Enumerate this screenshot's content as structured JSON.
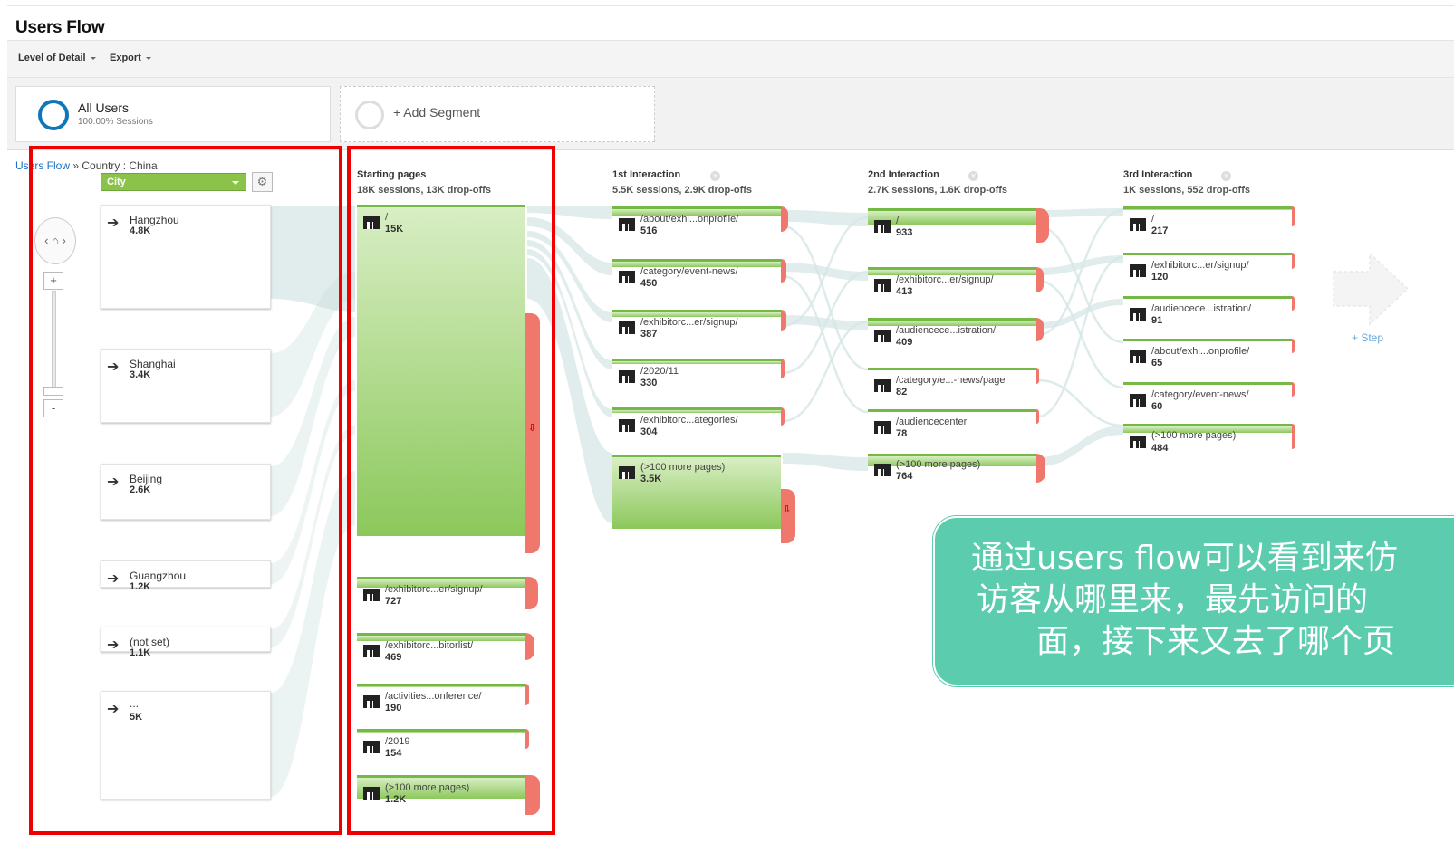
{
  "title": "Users Flow",
  "toolbar": {
    "level_of_detail": "Level of Detail",
    "export": "Export"
  },
  "segments": {
    "active": {
      "name": "All Users",
      "sub": "100.00% Sessions"
    },
    "add_label": "+ Add Segment"
  },
  "breadcrumb": {
    "root": "Users Flow",
    "sep": " » ",
    "current": "Country : China"
  },
  "dimension_select": {
    "value": "City"
  },
  "cities": [
    {
      "label": "Hangzhou",
      "value": "4.8K"
    },
    {
      "label": "Shanghai",
      "value": "3.4K"
    },
    {
      "label": "Beijing",
      "value": "2.6K"
    },
    {
      "label": "Guangzhou",
      "value": "1.2K"
    },
    {
      "label": "(not set)",
      "value": "1.1K"
    },
    {
      "label": "...",
      "value": "5K"
    }
  ],
  "columns": [
    {
      "title": "Starting pages",
      "sub": "18K sessions, 13K drop-offs",
      "nodes": [
        {
          "name": "/",
          "value": "15K"
        },
        {
          "name": "/exhibitorc...er/signup/",
          "value": "727"
        },
        {
          "name": "/exhibitorc...bitorlist/",
          "value": "469"
        },
        {
          "name": "/activities...onference/",
          "value": "190"
        },
        {
          "name": "/2019",
          "value": "154"
        },
        {
          "name": "(>100 more pages)",
          "value": "1.2K"
        }
      ]
    },
    {
      "title": "1st Interaction",
      "sub": "5.5K sessions, 2.9K drop-offs",
      "nodes": [
        {
          "name": "/about/exhi...onprofile/",
          "value": "516"
        },
        {
          "name": "/category/event-news/",
          "value": "450"
        },
        {
          "name": "/exhibitorc...er/signup/",
          "value": "387"
        },
        {
          "name": "/2020/11",
          "value": "330"
        },
        {
          "name": "/exhibitorc...ategories/",
          "value": "304"
        },
        {
          "name": "(>100 more pages)",
          "value": "3.5K"
        }
      ]
    },
    {
      "title": "2nd Interaction",
      "sub": "2.7K sessions, 1.6K drop-offs",
      "nodes": [
        {
          "name": "/",
          "value": "933"
        },
        {
          "name": "/exhibitorc...er/signup/",
          "value": "413"
        },
        {
          "name": "/audiencece...istration/",
          "value": "409"
        },
        {
          "name": "/category/e...-news/page",
          "value": "82"
        },
        {
          "name": "/audiencecenter",
          "value": "78"
        },
        {
          "name": "(>100 more pages)",
          "value": "764"
        }
      ]
    },
    {
      "title": "3rd Interaction",
      "sub": "1K sessions, 552 drop-offs",
      "nodes": [
        {
          "name": "/",
          "value": "217"
        },
        {
          "name": "/exhibitorc...er/signup/",
          "value": "120"
        },
        {
          "name": "/audiencece...istration/",
          "value": "91"
        },
        {
          "name": "/about/exhi...onprofile/",
          "value": "65"
        },
        {
          "name": "/category/event-news/",
          "value": "60"
        },
        {
          "name": "(>100 more pages)",
          "value": "484"
        }
      ]
    }
  ],
  "step_label": "+ Step",
  "callout": {
    "line1": "通过users flow可以看到来仿",
    "line2": "访客从哪里来，最先访问的",
    "line3": "面，接下来又去了哪个页"
  },
  "colors": {
    "node_green": "#8cc85b",
    "dropoff_red": "#f0776c",
    "highlight_red": "#ee0000",
    "callout_teal": "#5bcdae",
    "link_blue": "#1a6fc0"
  }
}
